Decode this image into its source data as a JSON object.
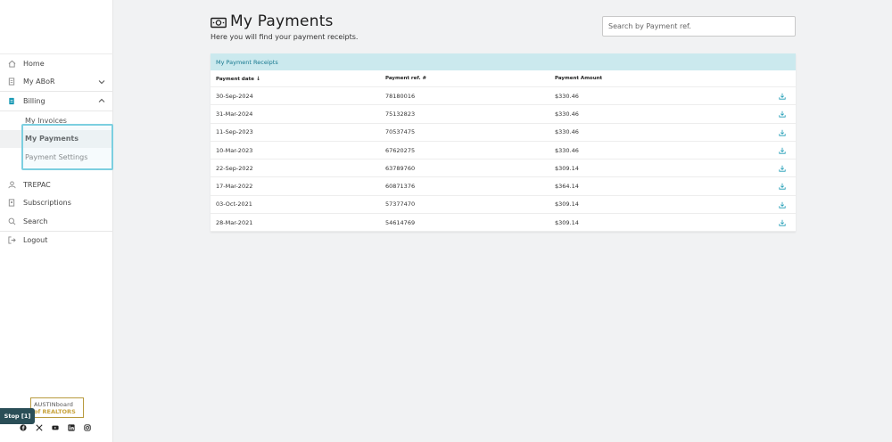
{
  "sidebar": {
    "items": [
      {
        "label": "Home",
        "icon": "home-icon"
      },
      {
        "label": "My ABoR",
        "icon": "document-icon"
      },
      {
        "label": "Billing",
        "icon": "billing-icon"
      }
    ],
    "billing_sub": [
      {
        "label": "My Invoices"
      },
      {
        "label": "My Payments",
        "active": true
      },
      {
        "label": "Payment Settings"
      }
    ],
    "items_after": [
      {
        "label": "TREPAC",
        "icon": "person-icon"
      },
      {
        "label": "Subscriptions",
        "icon": "subscriptions-icon"
      },
      {
        "label": "Search",
        "icon": "search-icon"
      }
    ],
    "logout": "Logout",
    "stop_label": "Stop [1]",
    "logo": {
      "line1a": "AUSTIN",
      "line1b": "board",
      "line2": "of REALTORS"
    }
  },
  "main": {
    "title": "My Payments",
    "subtitle": "Here you will find your payment receipts.",
    "search_placeholder": "Search by Payment ref."
  },
  "table": {
    "caption": "My Payment Receipts",
    "headers": {
      "date": "Payment date",
      "ref": "Payment ref. #",
      "amount": "Payment Amount"
    },
    "rows": [
      {
        "date": "30-Sep-2024",
        "ref": "78180016",
        "amount": "$330.46"
      },
      {
        "date": "31-Mar-2024",
        "ref": "75132823",
        "amount": "$330.46"
      },
      {
        "date": "11-Sep-2023",
        "ref": "70537475",
        "amount": "$330.46"
      },
      {
        "date": "10-Mar-2023",
        "ref": "67620275",
        "amount": "$330.46"
      },
      {
        "date": "22-Sep-2022",
        "ref": "63789760",
        "amount": "$309.14"
      },
      {
        "date": "17-Mar-2022",
        "ref": "60871376",
        "amount": "$364.14"
      },
      {
        "date": "03-Oct-2021",
        "ref": "57377470",
        "amount": "$309.14"
      },
      {
        "date": "28-Mar-2021",
        "ref": "54614769",
        "amount": "$309.14"
      }
    ]
  },
  "colors": {
    "accent": "#1a9ab5",
    "caption_bg": "#cbe9ee",
    "focus_ring": "#7ccfe0"
  }
}
